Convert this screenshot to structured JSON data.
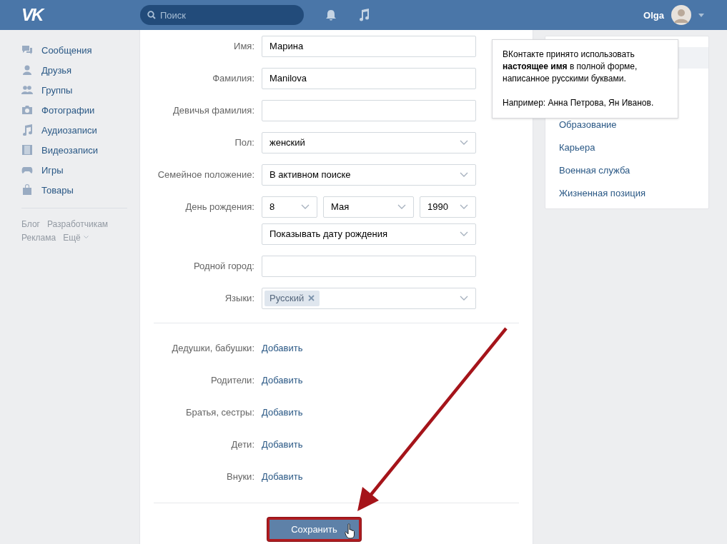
{
  "header": {
    "logo": "VK",
    "search": {
      "placeholder": "Поиск"
    },
    "user": {
      "name": "Olga"
    }
  },
  "sidebar": {
    "items": [
      {
        "label": "Сообщения"
      },
      {
        "label": "Друзья"
      },
      {
        "label": "Группы"
      },
      {
        "label": "Фотографии"
      },
      {
        "label": "Аудиозаписи"
      },
      {
        "label": "Видеозаписи"
      },
      {
        "label": "Игры"
      },
      {
        "label": "Товары"
      }
    ],
    "footer_links": [
      [
        "Блог",
        "Разработчикам"
      ],
      [
        "Реклама",
        "Ещё"
      ]
    ]
  },
  "form": {
    "rows": [
      {
        "kind": "input",
        "label": "Имя:",
        "value": "Марина"
      },
      {
        "kind": "input",
        "label": "Фамилия:",
        "value": "Manilova"
      },
      {
        "kind": "input",
        "label": "Девичья фамилия:"
      },
      {
        "kind": "select",
        "label": "Пол:",
        "value": "женский"
      },
      {
        "kind": "select",
        "label": "Семейное положение:",
        "value": "В активном поиске"
      },
      {
        "kind": "date",
        "label": "День рождения:",
        "day": "8",
        "month": "Мая",
        "year": "1990",
        "visibility": "Показывать дату рождения"
      },
      {
        "kind": "input",
        "label": "Родной город:"
      },
      {
        "kind": "tags",
        "label": "Языки:",
        "tags": [
          "Русский"
        ]
      }
    ],
    "relatives": [
      {
        "label": "Дедушки, бабушки:",
        "link": "Добавить"
      },
      {
        "label": "Родители:",
        "link": "Добавить"
      },
      {
        "label": "Братья, сестры:",
        "link": "Добавить"
      },
      {
        "label": "Дети:",
        "link": "Добавить"
      },
      {
        "label": "Внуки:",
        "link": "Добавить"
      }
    ],
    "save_button": "Сохранить"
  },
  "tooltip": {
    "paragraphs": [
      "ВКонтакте принято использовать **настоящее имя** в полной форме, написанное русскими буквами.",
      "Например: Анна Петрова, Ян Иванов."
    ]
  },
  "right_menu": {
    "items": [
      "Образование",
      "Карьера",
      "Военная служба",
      "Жизненная позиция"
    ]
  }
}
